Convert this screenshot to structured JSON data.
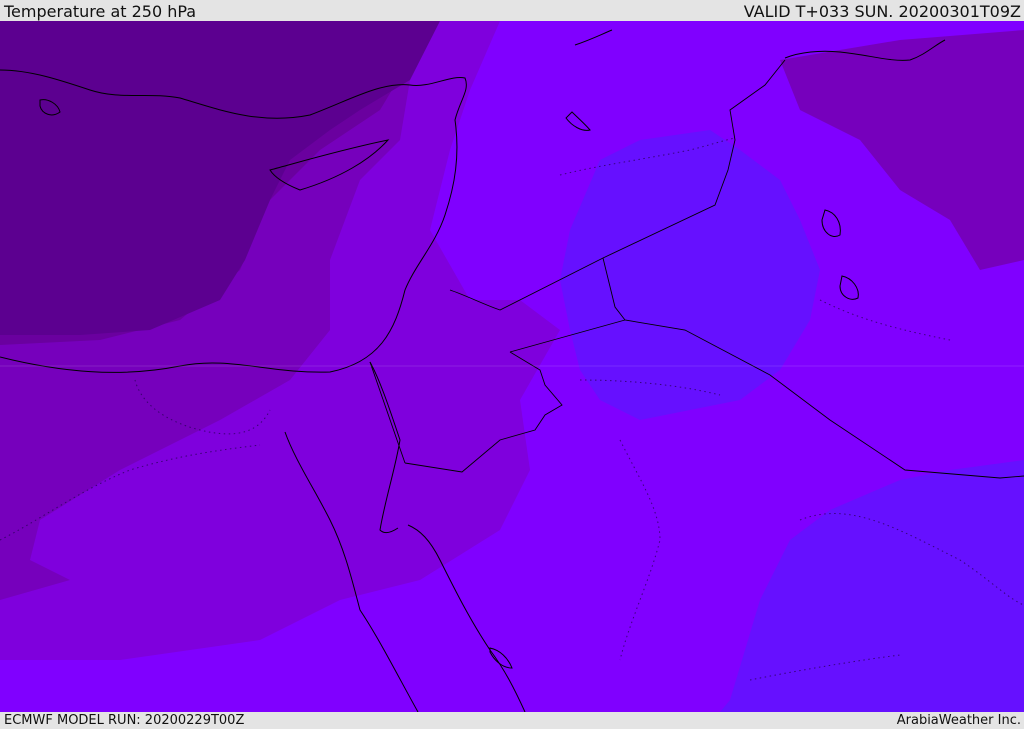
{
  "header": {
    "title": "Temperature at 250 hPa",
    "valid_time": "VALID T+033 SUN. 20200301T09Z"
  },
  "footer": {
    "model_run": "ECMWF MODEL RUN: 20200229T00Z",
    "credit": "ArabiaWeather Inc."
  },
  "map": {
    "field": "temperature",
    "pressure_level_hpa": 250,
    "colors": {
      "coldest": "#5c0090",
      "colder": "#6a009f",
      "cold": "#7600bc",
      "mid": "#7f00dd",
      "warm": "#8000ff",
      "warmer": "#6610ff",
      "borders": "#000000"
    }
  }
}
